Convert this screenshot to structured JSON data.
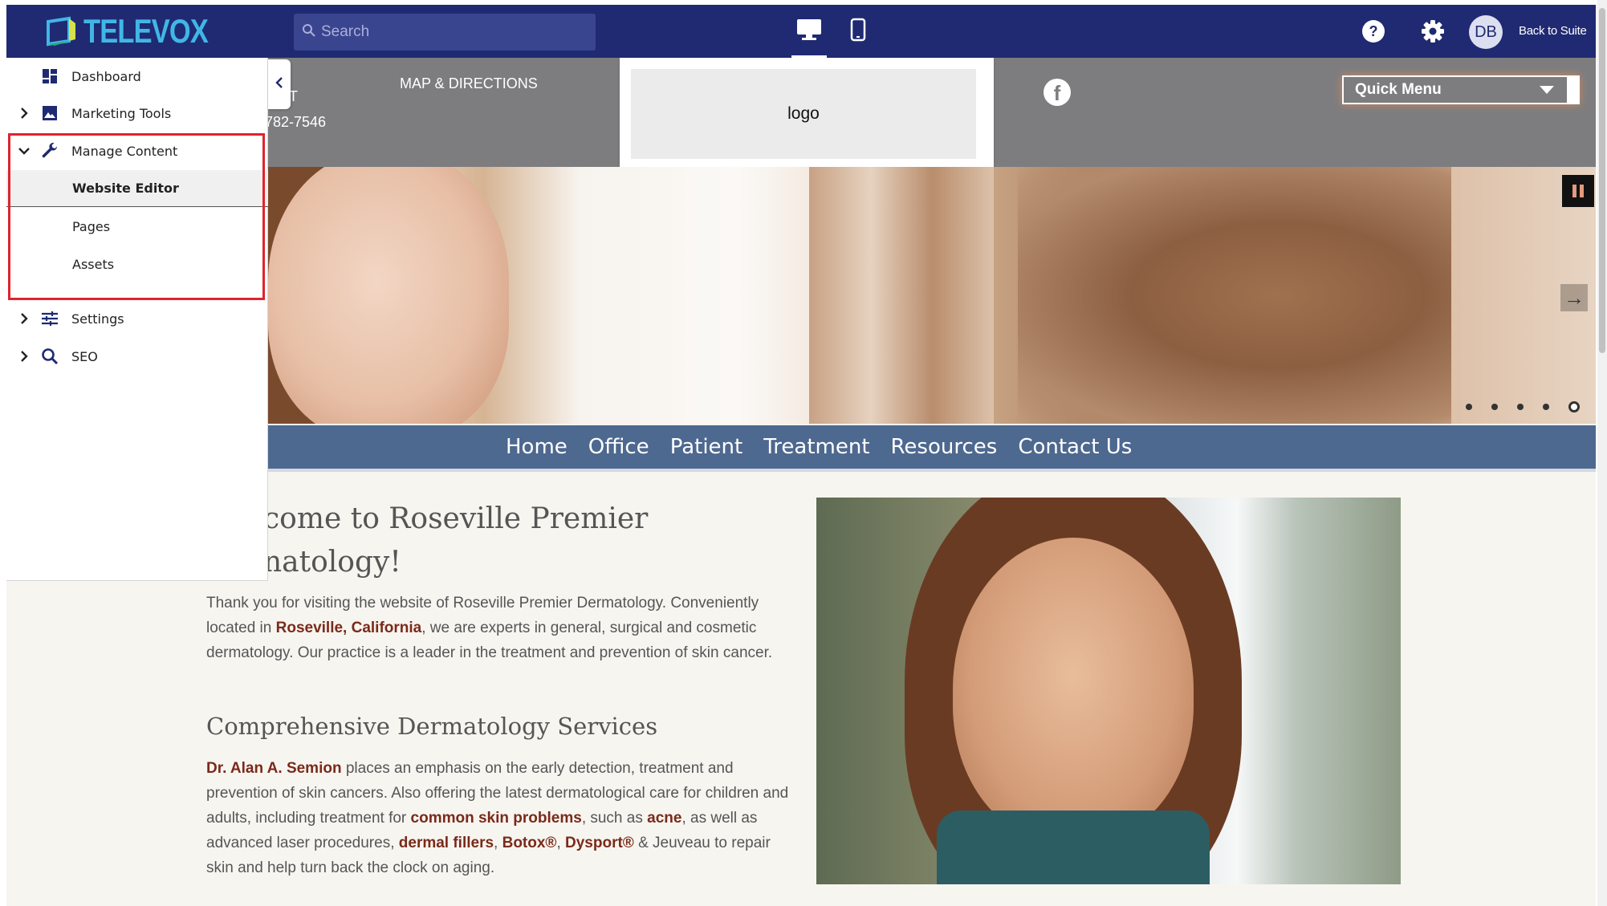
{
  "app": {
    "brand": "TELEVOX",
    "search_placeholder": "Search",
    "avatar_initials": "DB",
    "back_to_suite": "Back to Suite",
    "colors": {
      "topbar": "#1f2a72",
      "brand_accent": "#41b6e6",
      "highlight": "#e0232d"
    }
  },
  "sidebar": {
    "items": [
      {
        "label": "Dashboard",
        "icon": "dashboard-icon"
      },
      {
        "label": "Marketing Tools",
        "icon": "image-icon"
      },
      {
        "label": "Manage Content",
        "icon": "wrench-icon",
        "expanded": true
      },
      {
        "label": "Website Editor"
      },
      {
        "label": "Pages"
      },
      {
        "label": "Assets"
      },
      {
        "label": "Settings",
        "icon": "sliders-icon"
      },
      {
        "label": "SEO",
        "icon": "search-icon"
      }
    ]
  },
  "site": {
    "header": {
      "patient_partial": "IENT",
      "phone_partial": "782-7546",
      "map": "MAP & DIRECTIONS",
      "logo": "logo",
      "quick_menu": "Quick Menu"
    },
    "nav": [
      "Home",
      "Office",
      "Patient",
      "Treatment",
      "Resources",
      "Contact Us"
    ],
    "welcome_line1": "come to Roseville Premier",
    "welcome_line2": "natology!",
    "p1": {
      "a": "Thank you for visiting the website of Roseville Premier Dermatology. Conveniently located in ",
      "link": "Roseville, California",
      "b": ", we are experts in general, surgical and cosmetic dermatology. Our practice is a leader in the treatment and prevention of skin cancer."
    },
    "services_heading": "Comprehensive Dermatology Services",
    "p2": {
      "doctor": "Dr. Alan A. Semion",
      "a": " places an emphasis on the early detection, treatment and prevention of skin cancers.  Also offering the latest dermatological care for children and adults, including treatment for ",
      "link_skin": "common skin problems",
      "b": ", such as ",
      "link_acne": "acne",
      "c": ", as well as advanced laser procedures, ",
      "link_fillers": "dermal fillers",
      "comma1": ", ",
      "link_botox": "Botox®",
      "comma2": ", ",
      "link_dysport": "Dysport®",
      "d": " & Jeuveau to repair skin and help turn back the clock on aging."
    },
    "slider": {
      "slide_count": 5,
      "active_slide": 5
    }
  }
}
